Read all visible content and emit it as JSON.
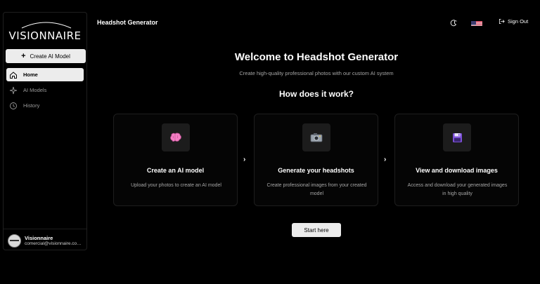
{
  "sidebar": {
    "logo_text": "VISIONNAIRE",
    "create_label": "Create AI Model",
    "nav": [
      {
        "label": "Home",
        "icon": "home-icon",
        "active": true
      },
      {
        "label": "AI Models",
        "icon": "sparkles-icon",
        "active": false
      },
      {
        "label": "History",
        "icon": "history-icon",
        "active": false
      }
    ],
    "user": {
      "name": "Visionnaire",
      "email": "comercial@visionnaire.com..."
    }
  },
  "header": {
    "title": "Headshot Generator",
    "signout_label": "Sign Out"
  },
  "main": {
    "welcome": "Welcome to Headshot Generator",
    "subtitle": "Create high-quality professional photos with our custom AI system",
    "how_title": "How does it work?",
    "steps": [
      {
        "title": "Create an AI model",
        "desc": "Upload your photos to create an AI model",
        "icon": "brain-icon"
      },
      {
        "title": "Generate your headshots",
        "desc": "Create professional images from your created model",
        "icon": "camera-icon"
      },
      {
        "title": "View and download images",
        "desc": "Access and download your generated images in high quality",
        "icon": "floppy-disk-icon"
      }
    ],
    "start_label": "Start here"
  },
  "colors": {
    "background": "#000000",
    "button_bg": "#ececec",
    "card_border": "#1e1e1e",
    "icon_box": "#1c1c1c",
    "muted_text": "#a6a6a6"
  }
}
